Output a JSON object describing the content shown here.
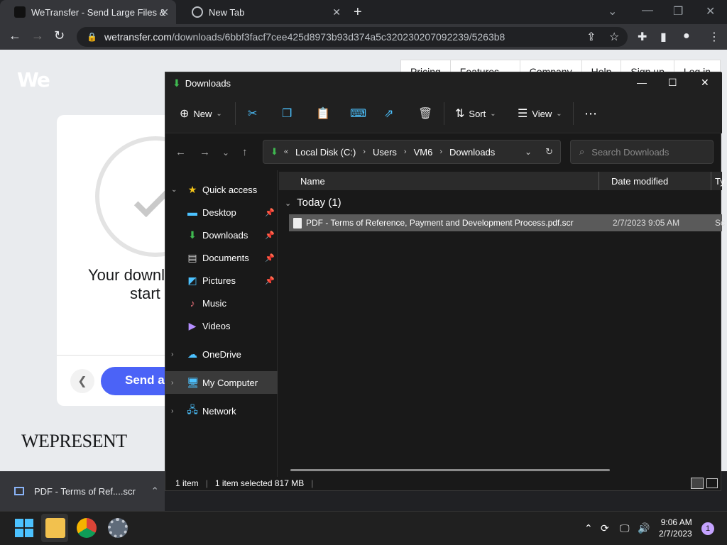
{
  "browser": {
    "tabs": [
      {
        "title": "WeTransfer - Send Large Files & ",
        "active": true
      },
      {
        "title": "New Tab",
        "active": false
      }
    ],
    "url_host": "wetransfer.com",
    "url_path": "/downloads/6bbf3facf7cee425d8973b93d374a5c320230207092239/5263b8"
  },
  "webpage": {
    "logo": "We",
    "nav": [
      "Pricing",
      "Features ⌄",
      "Company",
      "Help",
      "Sign up",
      "Log in"
    ],
    "download_text_1": "Your downl",
    "download_text_2": "start",
    "send_button": "Send a",
    "wepresent": "WEPRESENT"
  },
  "explorer": {
    "title": "Downloads",
    "commands": {
      "new": "New",
      "sort": "Sort",
      "view": "View"
    },
    "breadcrumb": [
      "Local Disk (C:)",
      "Users",
      "VM6",
      "Downloads"
    ],
    "search_placeholder": "Search Downloads",
    "nav": {
      "quick_access": "Quick access",
      "desktop": "Desktop",
      "downloads": "Downloads",
      "documents": "Documents",
      "pictures": "Pictures",
      "music": "Music",
      "videos": "Videos",
      "onedrive": "OneDrive",
      "my_computer": "My Computer",
      "network": "Network"
    },
    "columns": {
      "name": "Name",
      "date": "Date modified",
      "type": "Ty"
    },
    "group": "Today (1)",
    "file": {
      "name": "PDF - Terms of Reference, Payment and Development Process.pdf.scr",
      "date": "2/7/2023 9:05 AM",
      "type": "Sc"
    },
    "status": {
      "count": "1 item",
      "selected": "1 item selected  817 MB"
    }
  },
  "download_bar": {
    "file": "PDF - Terms of Ref....scr"
  },
  "taskbar": {
    "time": "9:06 AM",
    "date": "2/7/2023",
    "notifications": "1"
  }
}
